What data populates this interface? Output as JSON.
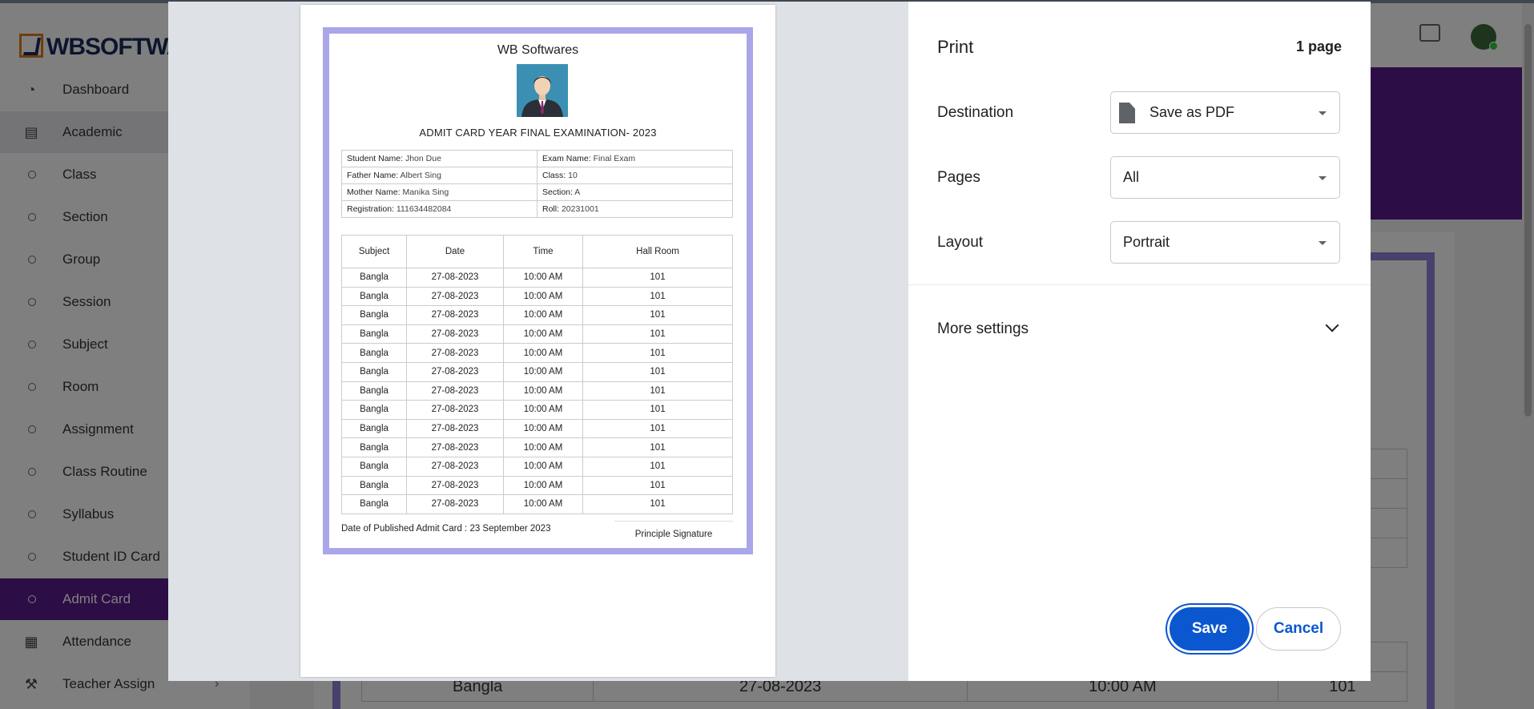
{
  "app": {
    "logo_text": "WBSOFTWARES",
    "nav": [
      {
        "label": "Dashboard",
        "icon": "dashboard-icon"
      },
      {
        "label": "Academic",
        "icon": "book-icon"
      },
      {
        "label": "Class",
        "icon": "circle-icon"
      },
      {
        "label": "Section",
        "icon": "circle-icon"
      },
      {
        "label": "Group",
        "icon": "circle-icon"
      },
      {
        "label": "Session",
        "icon": "circle-icon"
      },
      {
        "label": "Subject",
        "icon": "circle-icon"
      },
      {
        "label": "Room",
        "icon": "circle-icon"
      },
      {
        "label": "Assignment",
        "icon": "circle-icon"
      },
      {
        "label": "Class Routine",
        "icon": "circle-icon"
      },
      {
        "label": "Syllabus",
        "icon": "circle-icon"
      },
      {
        "label": "Student ID Card",
        "icon": "circle-icon"
      },
      {
        "label": "Admit Card",
        "icon": "circle-icon"
      },
      {
        "label": "Attendance",
        "icon": "grid-icon"
      },
      {
        "label": "Teacher Assign",
        "icon": "gavel-icon"
      }
    ],
    "accent_color": "#5b1a8c",
    "background_row": {
      "subject": "Bangla",
      "date": "27-08-2023",
      "time": "10:00 AM",
      "room": "101"
    }
  },
  "print_dialog": {
    "title": "Print",
    "page_count": "1 page",
    "destination_label": "Destination",
    "destination_value": "Save as PDF",
    "pages_label": "Pages",
    "pages_value": "All",
    "layout_label": "Layout",
    "layout_value": "Portrait",
    "more_settings": "More settings",
    "save_label": "Save",
    "cancel_label": "Cancel",
    "primary_color": "#0b57d0"
  },
  "admit_card": {
    "school": "WB Softwares",
    "title": "ADMIT CARD YEAR FINAL EXAMINATION- 2023",
    "info": {
      "student_name_label": "Student Name:",
      "student_name": "Jhon Due",
      "exam_name_label": "Exam Name:",
      "exam_name": "Final Exam",
      "father_name_label": "Father Name:",
      "father_name": "Albert Sing",
      "class_label": "Class:",
      "class": "10",
      "mother_name_label": "Mother Name:",
      "mother_name": "Manika Sing",
      "section_label": "Section:",
      "section": "A",
      "registration_label": "Registration:",
      "registration": "111634482084",
      "roll_label": "Roll:",
      "roll": "20231001"
    },
    "columns": [
      "Subject",
      "Date",
      "Time",
      "Hall Room"
    ],
    "rows": [
      [
        "Bangla",
        "27-08-2023",
        "10:00 AM",
        "101"
      ],
      [
        "Bangla",
        "27-08-2023",
        "10:00 AM",
        "101"
      ],
      [
        "Bangla",
        "27-08-2023",
        "10:00 AM",
        "101"
      ],
      [
        "Bangla",
        "27-08-2023",
        "10:00 AM",
        "101"
      ],
      [
        "Bangla",
        "27-08-2023",
        "10:00 AM",
        "101"
      ],
      [
        "Bangla",
        "27-08-2023",
        "10:00 AM",
        "101"
      ],
      [
        "Bangla",
        "27-08-2023",
        "10:00 AM",
        "101"
      ],
      [
        "Bangla",
        "27-08-2023",
        "10:00 AM",
        "101"
      ],
      [
        "Bangla",
        "27-08-2023",
        "10:00 AM",
        "101"
      ],
      [
        "Bangla",
        "27-08-2023",
        "10:00 AM",
        "101"
      ],
      [
        "Bangla",
        "27-08-2023",
        "10:00 AM",
        "101"
      ],
      [
        "Bangla",
        "27-08-2023",
        "10:00 AM",
        "101"
      ],
      [
        "Bangla",
        "27-08-2023",
        "10:00 AM",
        "101"
      ]
    ],
    "published": "Date of Published Admit Card : 23 September 2023",
    "signature": "Principle Signature",
    "border_color": "#aaa6ea"
  }
}
